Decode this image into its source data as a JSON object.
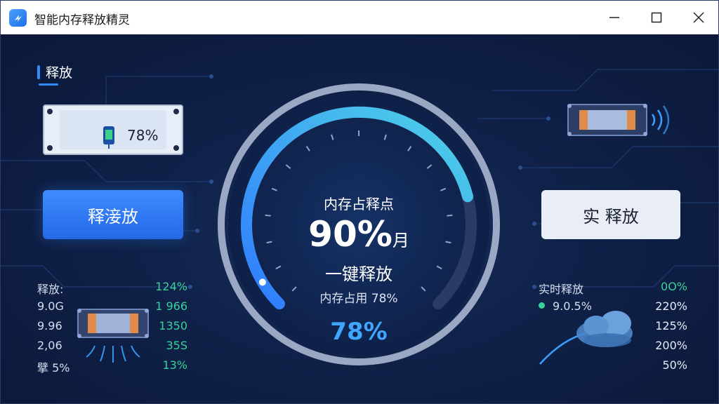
{
  "window": {
    "title": "智能内存释放精灵"
  },
  "colors": {
    "accent": "#2f8cff",
    "green": "#38d39a",
    "ring_start": "#2f7bff",
    "ring_end": "#4fd3e6"
  },
  "left": {
    "section_title": "释放",
    "memory_panel_value": "78%",
    "release_button": "释淁放",
    "stats": [
      {
        "label": "释放:",
        "value": "124%"
      },
      {
        "label": "9.0G",
        "value": "1 966"
      },
      {
        "label": "9.96",
        "value": "1350"
      },
      {
        "label": "2,06",
        "value": "35S"
      },
      {
        "label": "擘 5%",
        "value": "13%"
      }
    ]
  },
  "gauge": {
    "heading": "内存占释点",
    "big_value": "90%",
    "big_suffix": "月",
    "action": "一键释放",
    "usage_text": "内存占用 78%",
    "percent": "78%",
    "fill_fraction": 0.78
  },
  "right": {
    "realtime_button": "实 释放",
    "stats_title": "实时释放",
    "stats_title_value": "0O%",
    "row2_label": "9.0.5%",
    "values": [
      "220%",
      "125%",
      "200%",
      "50%"
    ]
  }
}
